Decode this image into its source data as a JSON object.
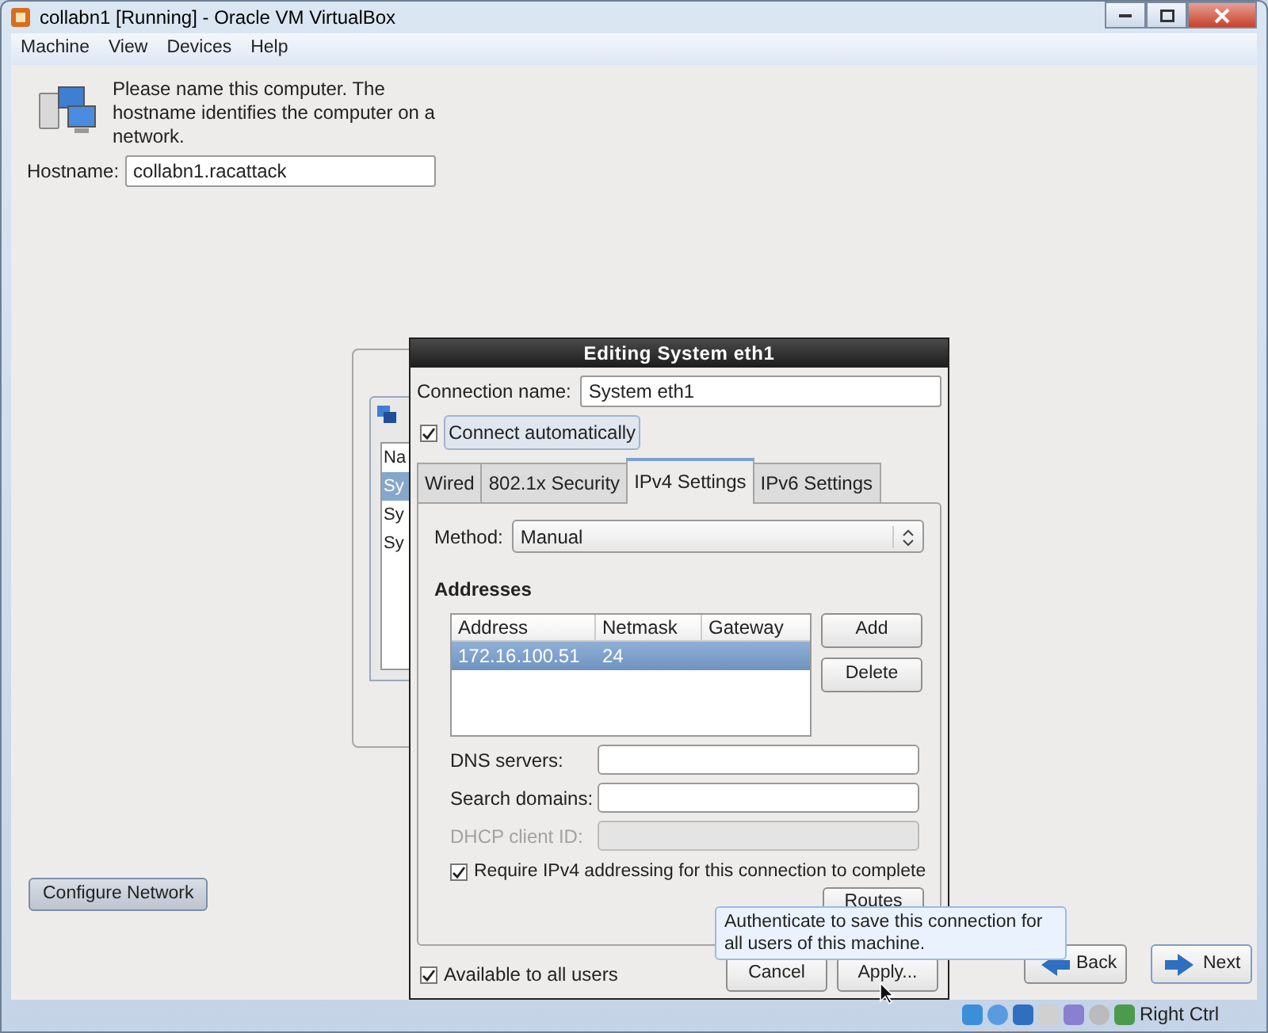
{
  "window": {
    "title": "collabn1 [Running] - Oracle VM VirtualBox"
  },
  "menu": [
    "Machine",
    "View",
    "Devices",
    "Help"
  ],
  "intro": {
    "text": "Please name this computer.  The hostname identifies the computer on a network."
  },
  "hostname": {
    "label": "Hostname:",
    "value": "collabn1.racattack"
  },
  "configure_button": "Configure Network",
  "background_window": {
    "list_header": "Na",
    "items": [
      {
        "label": "Sy",
        "selected": true
      },
      {
        "label": "Sy",
        "selected": false
      },
      {
        "label": "Sy",
        "selected": false
      }
    ]
  },
  "dialog": {
    "title": "Editing System eth1",
    "connection_name": {
      "label": "Connection name:",
      "value": "System eth1"
    },
    "connect_automatically": {
      "label": "Connect automatically",
      "checked": true
    },
    "tabs": [
      {
        "label": "Wired",
        "selected": false
      },
      {
        "label": "802.1x Security",
        "selected": false
      },
      {
        "label": "IPv4 Settings",
        "selected": true
      },
      {
        "label": "IPv6 Settings",
        "selected": false
      }
    ],
    "method": {
      "label": "Method:",
      "value": "Manual"
    },
    "addresses_heading": "Addresses",
    "columns": [
      "Address",
      "Netmask",
      "Gateway"
    ],
    "rows": [
      {
        "cells": [
          "172.16.100.51",
          "24"
        ],
        "selected": true
      }
    ],
    "address_buttons": [
      "Add",
      "Delete"
    ],
    "fields": [
      {
        "label": "DNS servers:",
        "disabled": false
      },
      {
        "label": "Search domains:",
        "disabled": false
      },
      {
        "label": "DHCP client ID:",
        "disabled": true
      }
    ],
    "require_ipv4": {
      "label": "Require IPv4 addressing for this connection to complete",
      "checked": true
    },
    "routes_button": "Routes",
    "available_to_all": {
      "label": "Available to all users",
      "checked": true
    },
    "buttons": [
      "Cancel",
      "Apply..."
    ]
  },
  "tooltip": "Authenticate to save this connection for all users of this machine.",
  "nav": [
    "Back",
    "Next"
  ],
  "status_bar": {
    "hotkey": "Right Ctrl"
  }
}
